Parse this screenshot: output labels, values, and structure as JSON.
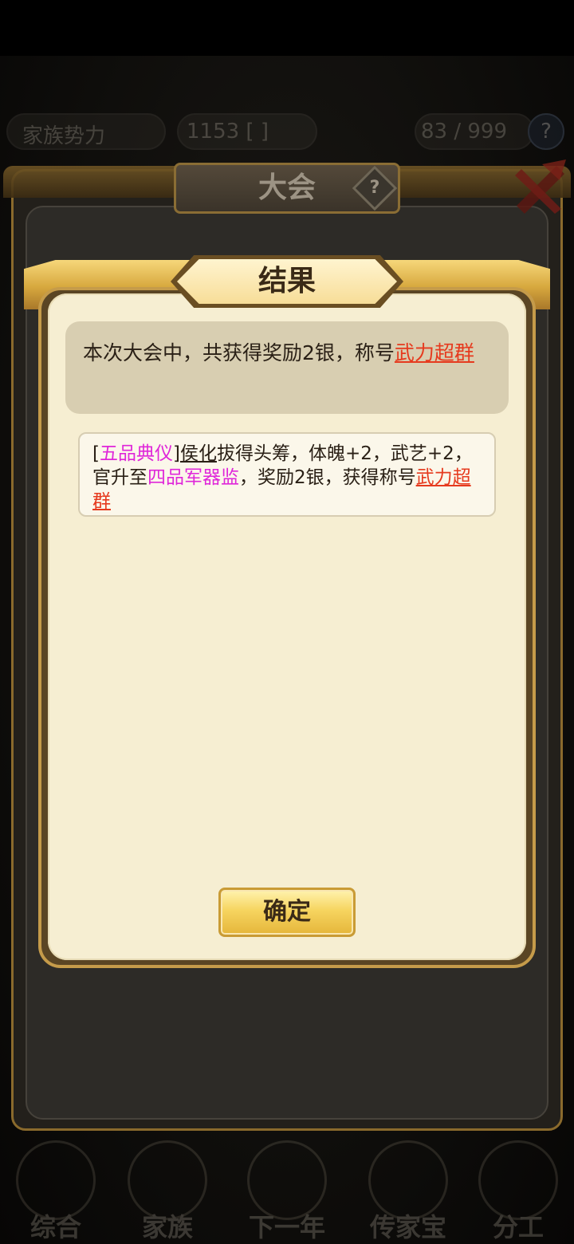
{
  "top_bar": {
    "faction_label": "家族势力",
    "value_text": "1153 [ ]",
    "counter_text": "83 / 999",
    "help_icon": "question-icon"
  },
  "outer_panel": {
    "title": "大会",
    "help_icon": "question-diamond-icon",
    "close_icon": "close-icon"
  },
  "result_dialog": {
    "title": "结果",
    "summary": {
      "text": "本次大会中，共获得奖励2银，称号",
      "title_highlight": "武力超群"
    },
    "detail": {
      "bracket_open": "[",
      "rank_tag": "五品典仪",
      "bracket_close": "]",
      "person_name": "侯化",
      "text_1": "拔得头筹，体魄+2，武艺+2，官升至",
      "new_post": "四品军器监",
      "text_2": "，奖励2银，获得称号",
      "title_highlight": "武力超群"
    },
    "confirm_label": "确定"
  },
  "bottom_nav": [
    {
      "label": "综合"
    },
    {
      "label": "家族"
    },
    {
      "label": "下一年"
    },
    {
      "label": "传家宝"
    },
    {
      "label": "分工"
    }
  ],
  "colors": {
    "title_red": "#e63a1e",
    "name_magenta": "#df26d9",
    "dialog_bg": "#f6eed2",
    "gold": "#e5b53a"
  }
}
